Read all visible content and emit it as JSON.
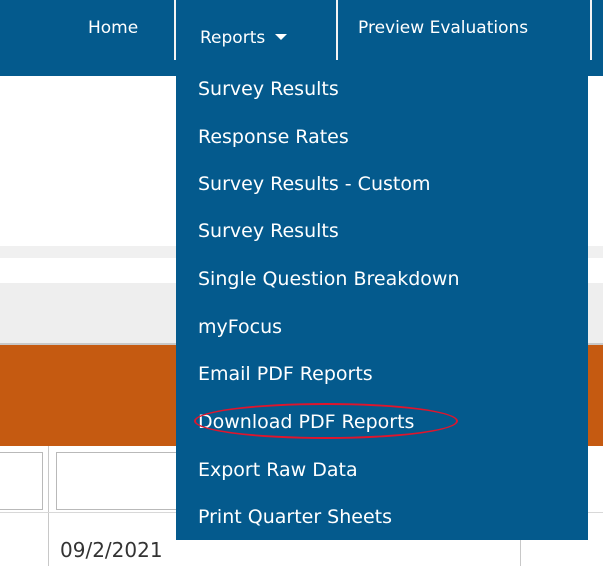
{
  "nav": {
    "home": "Home",
    "reports": "Reports",
    "preview": "Preview Evaluations"
  },
  "reports_menu": {
    "items": [
      "Survey Results",
      "Response Rates",
      "Survey Results - Custom",
      "Survey Results",
      "Single Question Breakdown",
      "myFocus",
      "Email PDF Reports",
      "Download PDF Reports",
      "Export Raw Data",
      "Print Quarter Sheets"
    ]
  },
  "table": {
    "first_date": "09/2/2021"
  },
  "colors": {
    "nav_blue": "#045a8d",
    "orange_band": "#c55a11",
    "highlight": "#e0152c"
  }
}
